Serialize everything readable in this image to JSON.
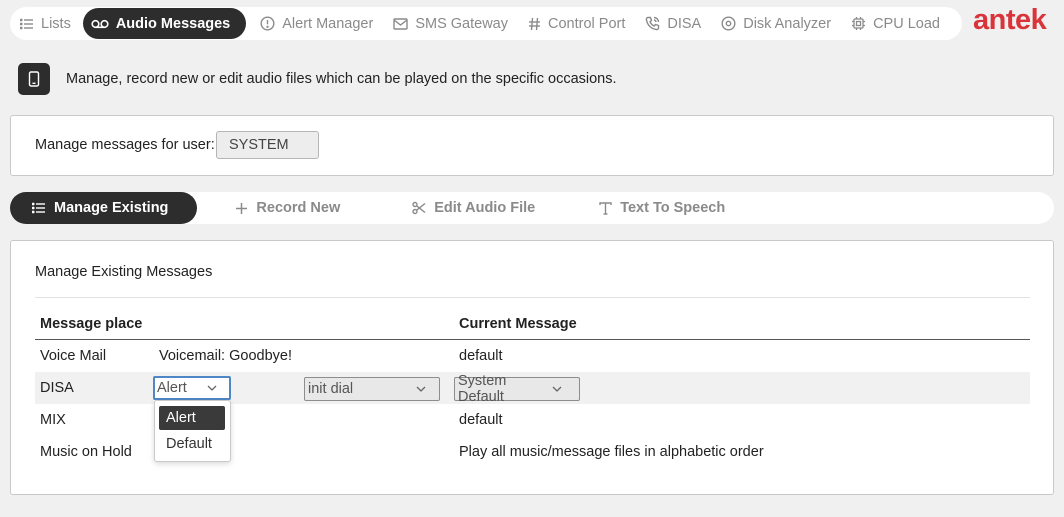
{
  "nav": {
    "items": [
      {
        "label": "Lists",
        "icon": "list-icon",
        "active": false
      },
      {
        "label": "Audio Messages",
        "icon": "voicemail-icon",
        "active": true
      },
      {
        "label": "Alert Manager",
        "icon": "alert-circle-icon",
        "active": false
      },
      {
        "label": "SMS Gateway",
        "icon": "mail-icon",
        "active": false
      },
      {
        "label": "Control Port",
        "icon": "hash-icon",
        "active": false
      },
      {
        "label": "DISA",
        "icon": "phone-icon",
        "active": false
      },
      {
        "label": "Disk Analyzer",
        "icon": "disk-icon",
        "active": false
      },
      {
        "label": "CPU Load",
        "icon": "cpu-icon",
        "active": false
      }
    ],
    "logo": "antek"
  },
  "info": {
    "text": "Manage, record new or edit audio files which can be played on the specific occasions."
  },
  "user": {
    "label": "Manage messages for user:",
    "value": "SYSTEM"
  },
  "tabs": [
    {
      "label": "Manage Existing",
      "icon": "list-icon",
      "active": true
    },
    {
      "label": "Record New",
      "icon": "plus-icon",
      "active": false
    },
    {
      "label": "Edit Audio File",
      "icon": "scissors-icon",
      "active": false
    },
    {
      "label": "Text To Speech",
      "icon": "text-icon",
      "active": false
    }
  ],
  "main": {
    "title": "Manage Existing Messages",
    "columns": {
      "place": "Message place",
      "current": "Current Message"
    },
    "rows": [
      {
        "place": "Voice Mail",
        "message": "Voicemail: Goodbye!",
        "current": "default"
      },
      {
        "place": "DISA",
        "select1": "Alert",
        "select2": "init dial",
        "select3": "System Default"
      },
      {
        "place": "MIX",
        "current": "default"
      },
      {
        "place": "Music on Hold",
        "current": "Play all music/message files in alphabetic order"
      }
    ],
    "dropdown": {
      "options": [
        "Alert",
        "Default"
      ],
      "selected": "Alert"
    }
  },
  "colors": {
    "accent": "#2d2d2d",
    "brand": "#d8343a",
    "focus": "#4f86c6"
  }
}
